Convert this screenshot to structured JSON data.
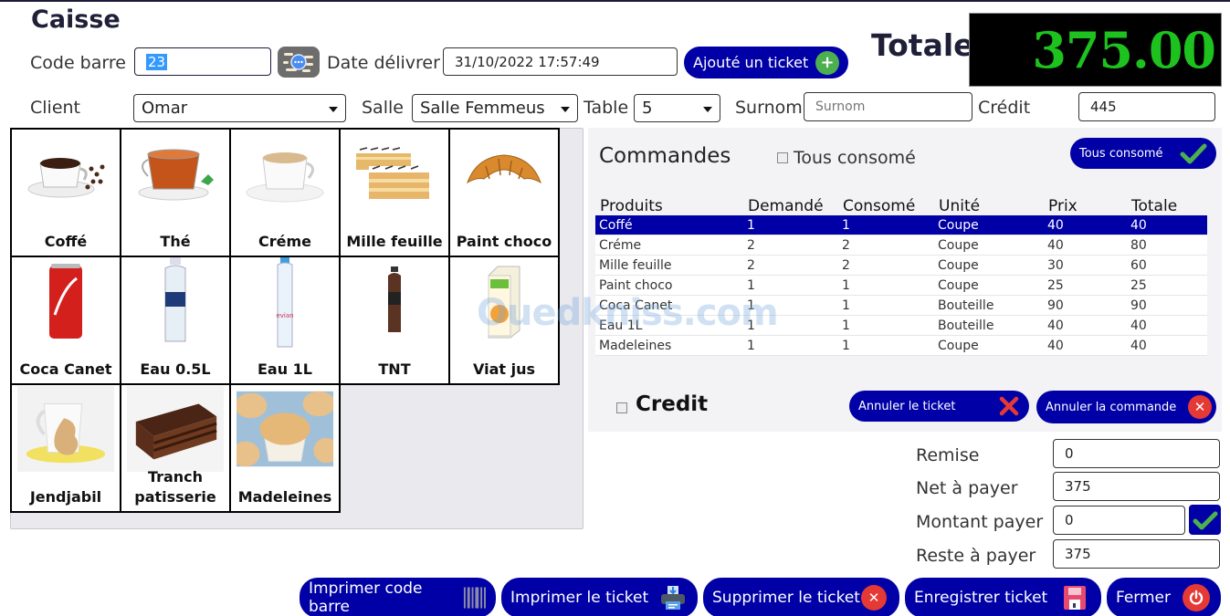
{
  "window": {
    "title": "Caisse"
  },
  "header": {
    "code_barre_label": "Code barre",
    "code_barre_value": "23",
    "search_icon": "search-scan-icon",
    "date_label": "Date délivrer",
    "date_value": "31/10/2022 17:57:49",
    "add_ticket_label": "Ajouté un ticket",
    "add_ticket_icon": "plus-circle-icon",
    "client_label": "Client",
    "client_value": "Omar",
    "salle_label": "Salle",
    "salle_value": "Salle Femmeus",
    "table_label": "Table",
    "table_value": "5",
    "surnom_label": "Surnom",
    "surnom_placeholder": "Surnom",
    "surnom_value": "",
    "credit_label": "Crédit",
    "credit_value": "445"
  },
  "total": {
    "label": "Totale",
    "value": "375.00",
    "color": "#1ec21e"
  },
  "products": [
    {
      "name": "Coffé",
      "image": "coffee-cup"
    },
    {
      "name": "Thé",
      "image": "tea-cup"
    },
    {
      "name": "Créme",
      "image": "cream-coffee-cup"
    },
    {
      "name": "Mille feuille",
      "image": "mille-feuille-pastry"
    },
    {
      "name": "Paint choco",
      "image": "croissant"
    },
    {
      "name": "Coca Canet",
      "image": "coca-can"
    },
    {
      "name": "Eau 0.5L",
      "image": "water-bottle-small"
    },
    {
      "name": "Eau 1L",
      "image": "water-bottle-large"
    },
    {
      "name": "TNT",
      "image": "soda-bottle"
    },
    {
      "name": "Viat jus",
      "image": "juice-carton"
    },
    {
      "name": "Jendjabil",
      "image": "ginger-tea"
    },
    {
      "name": "Tranch patisserie",
      "image": "chocolate-cake-slice"
    },
    {
      "name": "Madeleines",
      "image": "muffins"
    }
  ],
  "orders": {
    "title": "Commandes",
    "all_consumed_checkbox_label": "Tous consomé",
    "all_consumed_button_label": "Tous consomé",
    "columns": [
      "Produits",
      "Demandé",
      "Consomé",
      "Unité",
      "Prix",
      "Totale"
    ],
    "rows": [
      [
        "Coffé",
        "1",
        "1",
        "Coupe",
        "40",
        "40"
      ],
      [
        "Créme",
        "2",
        "2",
        "Coupe",
        "40",
        "80"
      ],
      [
        "Mille feuille",
        "2",
        "2",
        "Coupe",
        "30",
        "60"
      ],
      [
        "Paint choco",
        "1",
        "1",
        "Coupe",
        "25",
        "25"
      ],
      [
        "Coca Canet",
        "1",
        "1",
        "Bouteille",
        "90",
        "90"
      ],
      [
        "Eau 1L",
        "1",
        "1",
        "Bouteille",
        "40",
        "40"
      ],
      [
        "Madeleines",
        "1",
        "1",
        "Coupe",
        "40",
        "40"
      ]
    ],
    "selected_row": 0,
    "credit_checkbox_label": "Credit",
    "cancel_ticket_label": "Annuler le ticket",
    "cancel_order_label": "Annuler la commande"
  },
  "summary": {
    "remise_label": "Remise",
    "remise_value": "0",
    "net_label": "Net à payer",
    "net_value": "375",
    "montant_label": "Montant payer",
    "montant_value": "0",
    "reste_label": "Reste à payer",
    "reste_value": "375"
  },
  "footer": {
    "print_barcode_label": "Imprimer code barre",
    "print_ticket_label": "Imprimer le ticket",
    "delete_ticket_label": "Supprimer le ticket",
    "save_ticket_label": "Enregistrer ticket",
    "close_label": "Fermer"
  },
  "watermark": "Ouedkniss.com",
  "colors": {
    "primary_button": "#0000a6",
    "accent_green": "#4caf50",
    "danger_red": "#e53935"
  }
}
